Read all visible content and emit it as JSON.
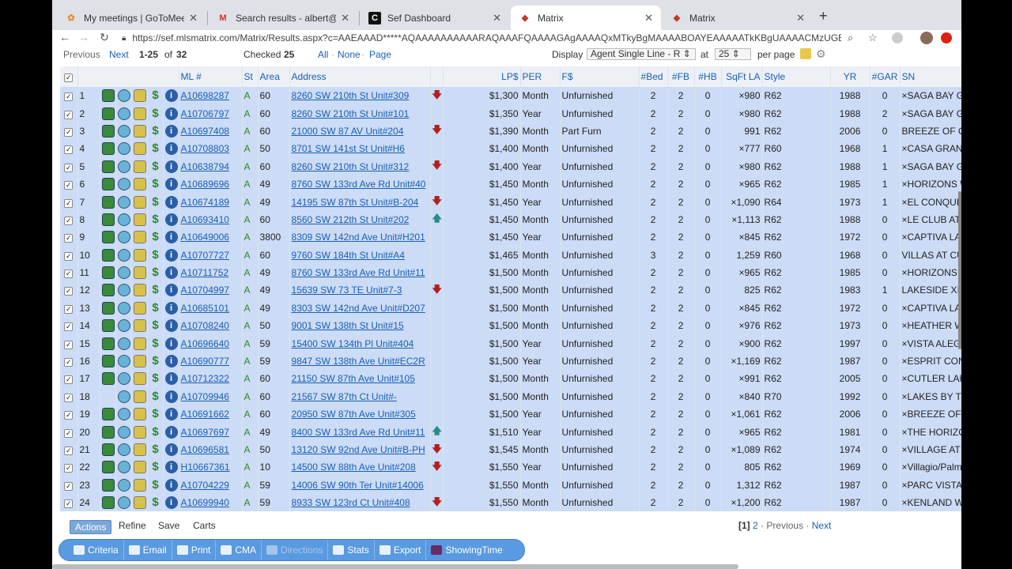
{
  "browser": {
    "tabs": [
      {
        "title": "My meetings | GoToMeeting",
        "icon": "gotomeeting-icon",
        "active": false
      },
      {
        "title": "Search results - albert@realesta",
        "icon": "gmail-icon",
        "active": false
      },
      {
        "title": "Sef Dashboard",
        "icon": "c-app-icon",
        "active": false
      },
      {
        "title": "Matrix",
        "icon": "matrix-icon",
        "active": true
      },
      {
        "title": "Matrix",
        "icon": "matrix-icon",
        "active": false
      }
    ],
    "url": "https://sef.mlsmatrix.com/Matrix/Results.aspx?c=AAEAAAD*****AQAAAAAAAAAARAQAAAFQAAAAGAgAAAAQxMTkyBgMAAAABOAYEAAAAATkKBgUAAAACMzUGBgAAA..."
  },
  "pager": {
    "previous": "Previous",
    "next": "Next",
    "range": "1-25",
    "of_label": "of",
    "total": "32",
    "checked_label": "Checked",
    "checked_count": "25",
    "all": "All",
    "none": "None",
    "page": "Page",
    "display_label": "Display",
    "display_value": "Agent Single Line - R",
    "at_label": "at",
    "per_page_value": "25",
    "per_page_label": "per page"
  },
  "columns": [
    "ML #",
    "St",
    "Area",
    "Address",
    "LP$",
    "PER",
    "F$",
    "#Bed",
    "#FB",
    "#HB",
    "SqFt LA",
    "Style",
    "YR",
    "#GAR",
    "SN"
  ],
  "rows": [
    {
      "n": "1",
      "ml": "A10698287",
      "st": "A",
      "area": "60",
      "addr": "8260 SW 210th St Unit#309",
      "arrow": "down",
      "lp": "$1,300",
      "per": "Month",
      "f": "Unfurnished",
      "bed": "2",
      "fb": "2",
      "hb": "0",
      "sqft": "×980",
      "style": "R62",
      "yr": "1988",
      "gar": "0",
      "sn": "×SAGA BAY GA",
      "icons": true
    },
    {
      "n": "2",
      "ml": "A10706797",
      "st": "A",
      "area": "60",
      "addr": "8260 SW 210th St Unit#101",
      "arrow": "",
      "lp": "$1,350",
      "per": "Year",
      "f": "Unfurnished",
      "bed": "2",
      "fb": "2",
      "hb": "0",
      "sqft": "×980",
      "style": "R62",
      "yr": "1988",
      "gar": "2",
      "sn": "×SAGA BAY GA",
      "icons": true
    },
    {
      "n": "3",
      "ml": "A10697408",
      "st": "A",
      "area": "60",
      "addr": "21000 SW 87 AV Unit#204",
      "arrow": "down",
      "lp": "$1,390",
      "per": "Month",
      "f": "Part Furn",
      "bed": "2",
      "fb": "2",
      "hb": "0",
      "sqft": "991",
      "style": "R62",
      "yr": "2006",
      "gar": "0",
      "sn": "BREEZE OF GA",
      "icons": true
    },
    {
      "n": "4",
      "ml": "A10708803",
      "st": "A",
      "area": "50",
      "addr": "8701 SW 141st St Unit#H6",
      "arrow": "",
      "lp": "$1,400",
      "per": "Month",
      "f": "Unfurnished",
      "bed": "2",
      "fb": "2",
      "hb": "0",
      "sqft": "×777",
      "style": "R60",
      "yr": "1968",
      "gar": "1",
      "sn": "×CASA GRANAD",
      "icons": true
    },
    {
      "n": "5",
      "ml": "A10638794",
      "st": "A",
      "area": "60",
      "addr": "8260 SW 210th St Unit#312",
      "arrow": "down",
      "lp": "$1,400",
      "per": "Year",
      "f": "Unfurnished",
      "bed": "2",
      "fb": "2",
      "hb": "0",
      "sqft": "×980",
      "style": "R62",
      "yr": "1988",
      "gar": "1",
      "sn": "×SAGA BAY GA",
      "icons": true
    },
    {
      "n": "6",
      "ml": "A10689696",
      "st": "A",
      "area": "49",
      "addr": "8760 SW 133rd Ave Rd Unit#40",
      "arrow": "",
      "lp": "$1,450",
      "per": "Month",
      "f": "Unfurnished",
      "bed": "2",
      "fb": "2",
      "hb": "0",
      "sqft": "×965",
      "style": "R62",
      "yr": "1985",
      "gar": "1",
      "sn": "×HORIZONS W",
      "icons": true
    },
    {
      "n": "7",
      "ml": "A10674189",
      "st": "A",
      "area": "49",
      "addr": "14195 SW 87th St Unit#B-204",
      "arrow": "down",
      "lp": "$1,450",
      "per": "Year",
      "f": "Unfurnished",
      "bed": "2",
      "fb": "2",
      "hb": "0",
      "sqft": "×1,090",
      "style": "R64",
      "yr": "1973",
      "gar": "1",
      "sn": "×EL CONQUIST",
      "icons": true
    },
    {
      "n": "8",
      "ml": "A10693410",
      "st": "A",
      "area": "60",
      "addr": "8560 SW 212th St Unit#202",
      "arrow": "up",
      "lp": "$1,450",
      "per": "Month",
      "f": "Unfurnished",
      "bed": "2",
      "fb": "2",
      "hb": "0",
      "sqft": "×1,113",
      "style": "R62",
      "yr": "1988",
      "gar": "0",
      "sn": "×LE CLUB AT O",
      "icons": true
    },
    {
      "n": "9",
      "ml": "A10649006",
      "st": "A",
      "area": "3800",
      "addr": "8309 SW 142nd Ave Unit#H201",
      "arrow": "",
      "lp": "$1,450",
      "per": "Year",
      "f": "Unfurnished",
      "bed": "2",
      "fb": "2",
      "hb": "0",
      "sqft": "×845",
      "style": "R62",
      "yr": "1972",
      "gar": "0",
      "sn": "×CAPTIVA LAKE",
      "icons": true
    },
    {
      "n": "10",
      "ml": "A10707727",
      "st": "A",
      "area": "60",
      "addr": "9760 SW 184th St Unit#A4",
      "arrow": "",
      "lp": "$1,465",
      "per": "Month",
      "f": "Unfurnished",
      "bed": "3",
      "fb": "2",
      "hb": "0",
      "sqft": "1,259",
      "style": "R60",
      "yr": "1968",
      "gar": "0",
      "sn": "VILLAS AT CUT",
      "icons": true
    },
    {
      "n": "11",
      "ml": "A10711752",
      "st": "A",
      "area": "49",
      "addr": "8760 SW 133rd Ave Rd Unit#11",
      "arrow": "",
      "lp": "$1,500",
      "per": "Month",
      "f": "Unfurnished",
      "bed": "2",
      "fb": "2",
      "hb": "0",
      "sqft": "×965",
      "style": "R62",
      "yr": "1985",
      "gar": "0",
      "sn": "×HORIZONS W",
      "icons": true
    },
    {
      "n": "12",
      "ml": "A10704997",
      "st": "A",
      "area": "49",
      "addr": "15639 SW 73 TE Unit#7-3",
      "arrow": "down",
      "lp": "$1,500",
      "per": "Month",
      "f": "Unfurnished",
      "bed": "2",
      "fb": "2",
      "hb": "0",
      "sqft": "825",
      "style": "R62",
      "yr": "1983",
      "gar": "1",
      "sn": "LAKESIDE XI C",
      "icons": true
    },
    {
      "n": "13",
      "ml": "A10685101",
      "st": "A",
      "area": "49",
      "addr": "8303 SW 142nd Ave Unit#D207",
      "arrow": "",
      "lp": "$1,500",
      "per": "Month",
      "f": "Unfurnished",
      "bed": "2",
      "fb": "2",
      "hb": "0",
      "sqft": "×845",
      "style": "R62",
      "yr": "1972",
      "gar": "0",
      "sn": "×CAPTIVA LAKE",
      "icons": true
    },
    {
      "n": "14",
      "ml": "A10708240",
      "st": "A",
      "area": "50",
      "addr": "9001 SW 138th St Unit#15",
      "arrow": "",
      "lp": "$1,500",
      "per": "Month",
      "f": "Unfurnished",
      "bed": "2",
      "fb": "2",
      "hb": "0",
      "sqft": "×976",
      "style": "R62",
      "yr": "1973",
      "gar": "0",
      "sn": "×HEATHER WA",
      "icons": true
    },
    {
      "n": "15",
      "ml": "A10696640",
      "st": "A",
      "area": "59",
      "addr": "15400 SW 134th Pl Unit#404",
      "arrow": "",
      "lp": "$1,500",
      "per": "Year",
      "f": "Unfurnished",
      "bed": "2",
      "fb": "2",
      "hb": "0",
      "sqft": "×900",
      "style": "R62",
      "yr": "1997",
      "gar": "0",
      "sn": "×VISTA ALEGRE",
      "icons": true
    },
    {
      "n": "16",
      "ml": "A10690777",
      "st": "A",
      "area": "59",
      "addr": "9847 SW 138th Ave Unit#EC2R",
      "arrow": "",
      "lp": "$1,500",
      "per": "Year",
      "f": "Unfurnished",
      "bed": "2",
      "fb": "2",
      "hb": "0",
      "sqft": "×1,169",
      "style": "R62",
      "yr": "1987",
      "gar": "0",
      "sn": "×ESPRIT COND",
      "icons": true
    },
    {
      "n": "17",
      "ml": "A10712322",
      "st": "A",
      "area": "60",
      "addr": "21150 SW 87th Ave Unit#105",
      "arrow": "",
      "lp": "$1,500",
      "per": "Month",
      "f": "Unfurnished",
      "bed": "2",
      "fb": "2",
      "hb": "0",
      "sqft": "×991",
      "style": "R62",
      "yr": "2005",
      "gar": "0",
      "sn": "×CUTLER LAKE",
      "icons": true
    },
    {
      "n": "18",
      "ml": "A10709946",
      "st": "A",
      "area": "60",
      "addr": "21567 SW 87th Ct Unit#-",
      "arrow": "",
      "lp": "$1,500",
      "per": "Month",
      "f": "Unfurnished",
      "bed": "2",
      "fb": "2",
      "hb": "0",
      "sqft": "×840",
      "style": "R70",
      "yr": "1992",
      "gar": "0",
      "sn": "×LAKES BY THE",
      "icons": false
    },
    {
      "n": "19",
      "ml": "A10691662",
      "st": "A",
      "area": "60",
      "addr": "20950 SW 87th Ave Unit#305",
      "arrow": "",
      "lp": "$1,500",
      "per": "Year",
      "f": "Unfurnished",
      "bed": "2",
      "fb": "2",
      "hb": "0",
      "sqft": "×1,061",
      "style": "R62",
      "yr": "2006",
      "gar": "0",
      "sn": "×BREEZE OF GA",
      "icons": true
    },
    {
      "n": "20",
      "ml": "A10697697",
      "st": "A",
      "area": "49",
      "addr": "8400 SW 133rd Ave Rd Unit#11",
      "arrow": "up",
      "lp": "$1,510",
      "per": "Year",
      "f": "Unfurnished",
      "bed": "2",
      "fb": "2",
      "hb": "0",
      "sqft": "×965",
      "style": "R62",
      "yr": "1981",
      "gar": "0",
      "sn": "×THE HORIZON",
      "icons": true
    },
    {
      "n": "21",
      "ml": "A10696581",
      "st": "A",
      "area": "50",
      "addr": "13120 SW 92nd Ave Unit#B-PH",
      "arrow": "down",
      "lp": "$1,545",
      "per": "Month",
      "f": "Unfurnished",
      "bed": "2",
      "fb": "2",
      "hb": "0",
      "sqft": "×1,089",
      "style": "R62",
      "yr": "1974",
      "gar": "0",
      "sn": "×VILLAGE AT T",
      "icons": true
    },
    {
      "n": "22",
      "ml": "H10667361",
      "st": "A",
      "area": "10",
      "addr": "14500 SW 88th Ave Unit#208",
      "arrow": "down",
      "lp": "$1,550",
      "per": "Year",
      "f": "Unfurnished",
      "bed": "2",
      "fb": "2",
      "hb": "0",
      "sqft": "805",
      "style": "R62",
      "yr": "1969",
      "gar": "0",
      "sn": "×Villagio/Palme",
      "icons": true
    },
    {
      "n": "23",
      "ml": "A10704229",
      "st": "A",
      "area": "59",
      "addr": "14006 SW 90th Ter Unit#14006",
      "arrow": "",
      "lp": "$1,550",
      "per": "Month",
      "f": "Unfurnished",
      "bed": "2",
      "fb": "2",
      "hb": "0",
      "sqft": "1,312",
      "style": "R62",
      "yr": "1987",
      "gar": "0",
      "sn": "×PARC VISTA C",
      "icons": true
    },
    {
      "n": "24",
      "ml": "A10699940",
      "st": "A",
      "area": "59",
      "addr": "8933 SW 123rd Ct Unit#408",
      "arrow": "down",
      "lp": "$1,550",
      "per": "Month",
      "f": "Unfurnished",
      "bed": "2",
      "fb": "2",
      "hb": "0",
      "sqft": "×1,200",
      "style": "R62",
      "yr": "1987",
      "gar": "0",
      "sn": "×KENLAND WA",
      "icons": true
    }
  ],
  "footer": {
    "tabs": [
      "Actions",
      "Refine",
      "Save",
      "Carts"
    ],
    "pages_current": "[1]",
    "pages_next": "2",
    "previous": "Previous",
    "next": "Next",
    "buttons": [
      {
        "label": "Criteria",
        "icon": "search-icon",
        "enabled": true
      },
      {
        "label": "Email",
        "icon": "email-icon",
        "enabled": true
      },
      {
        "label": "Print",
        "icon": "print-icon",
        "enabled": true
      },
      {
        "label": "CMA",
        "icon": "cma-icon",
        "enabled": true
      },
      {
        "label": "Directions",
        "icon": "directions-icon",
        "enabled": false
      },
      {
        "label": "Stats",
        "icon": "stats-icon",
        "enabled": true
      },
      {
        "label": "Export",
        "icon": "export-icon",
        "enabled": true
      },
      {
        "label": "ShowingTime",
        "icon": "showingtime-icon",
        "enabled": true
      }
    ]
  },
  "colors": {
    "row_bg": "#ccdcf6",
    "link": "#1a5fb4",
    "down_arrow": "#b02020",
    "up_arrow": "#2a8a8a",
    "button_bar": "#5a9ae0"
  }
}
